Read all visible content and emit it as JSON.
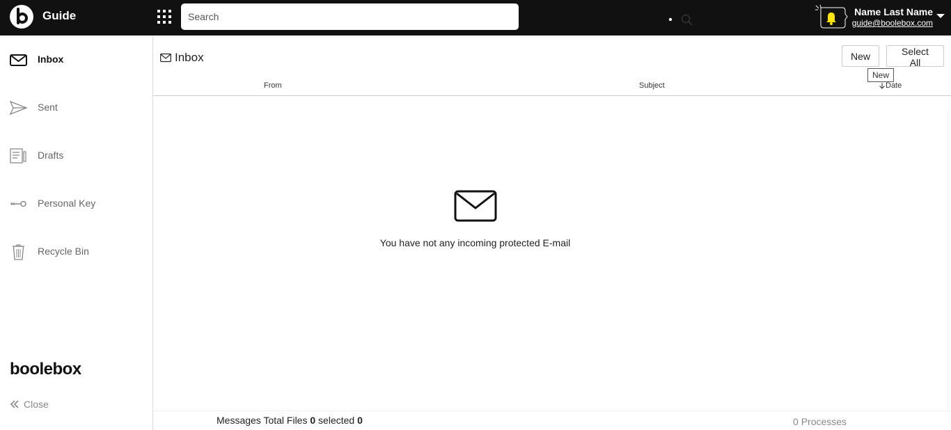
{
  "header": {
    "app_title": "Guide",
    "search_placeholder": "Search",
    "user_name": "Name Last Name",
    "user_email": "guide@boolebox.com"
  },
  "sidebar": {
    "items": [
      {
        "label": "Inbox",
        "icon": "mail-icon",
        "active": true
      },
      {
        "label": "Sent",
        "icon": "send-icon",
        "active": false
      },
      {
        "label": "Drafts",
        "icon": "drafts-icon",
        "active": false
      },
      {
        "label": "Personal Key",
        "icon": "key-icon",
        "active": false
      },
      {
        "label": "Recycle Bin",
        "icon": "trash-icon",
        "active": false
      }
    ],
    "brand": "boolebox",
    "close_label": "Close"
  },
  "main": {
    "title": "Inbox",
    "new_label": "New",
    "select_all_label": "Select All",
    "tooltip": "New",
    "columns": {
      "from": "From",
      "subject": "Subject",
      "date": "Date"
    },
    "empty_message": "You have not any incoming protected E-mail"
  },
  "footer": {
    "messages_label": "Messages Total Files",
    "total": "0",
    "selected_label": "selected",
    "selected": "0",
    "processes_count": "0",
    "processes_label": "Processes"
  },
  "colors": {
    "topbar": "#111111",
    "bell": "#ffe600"
  }
}
